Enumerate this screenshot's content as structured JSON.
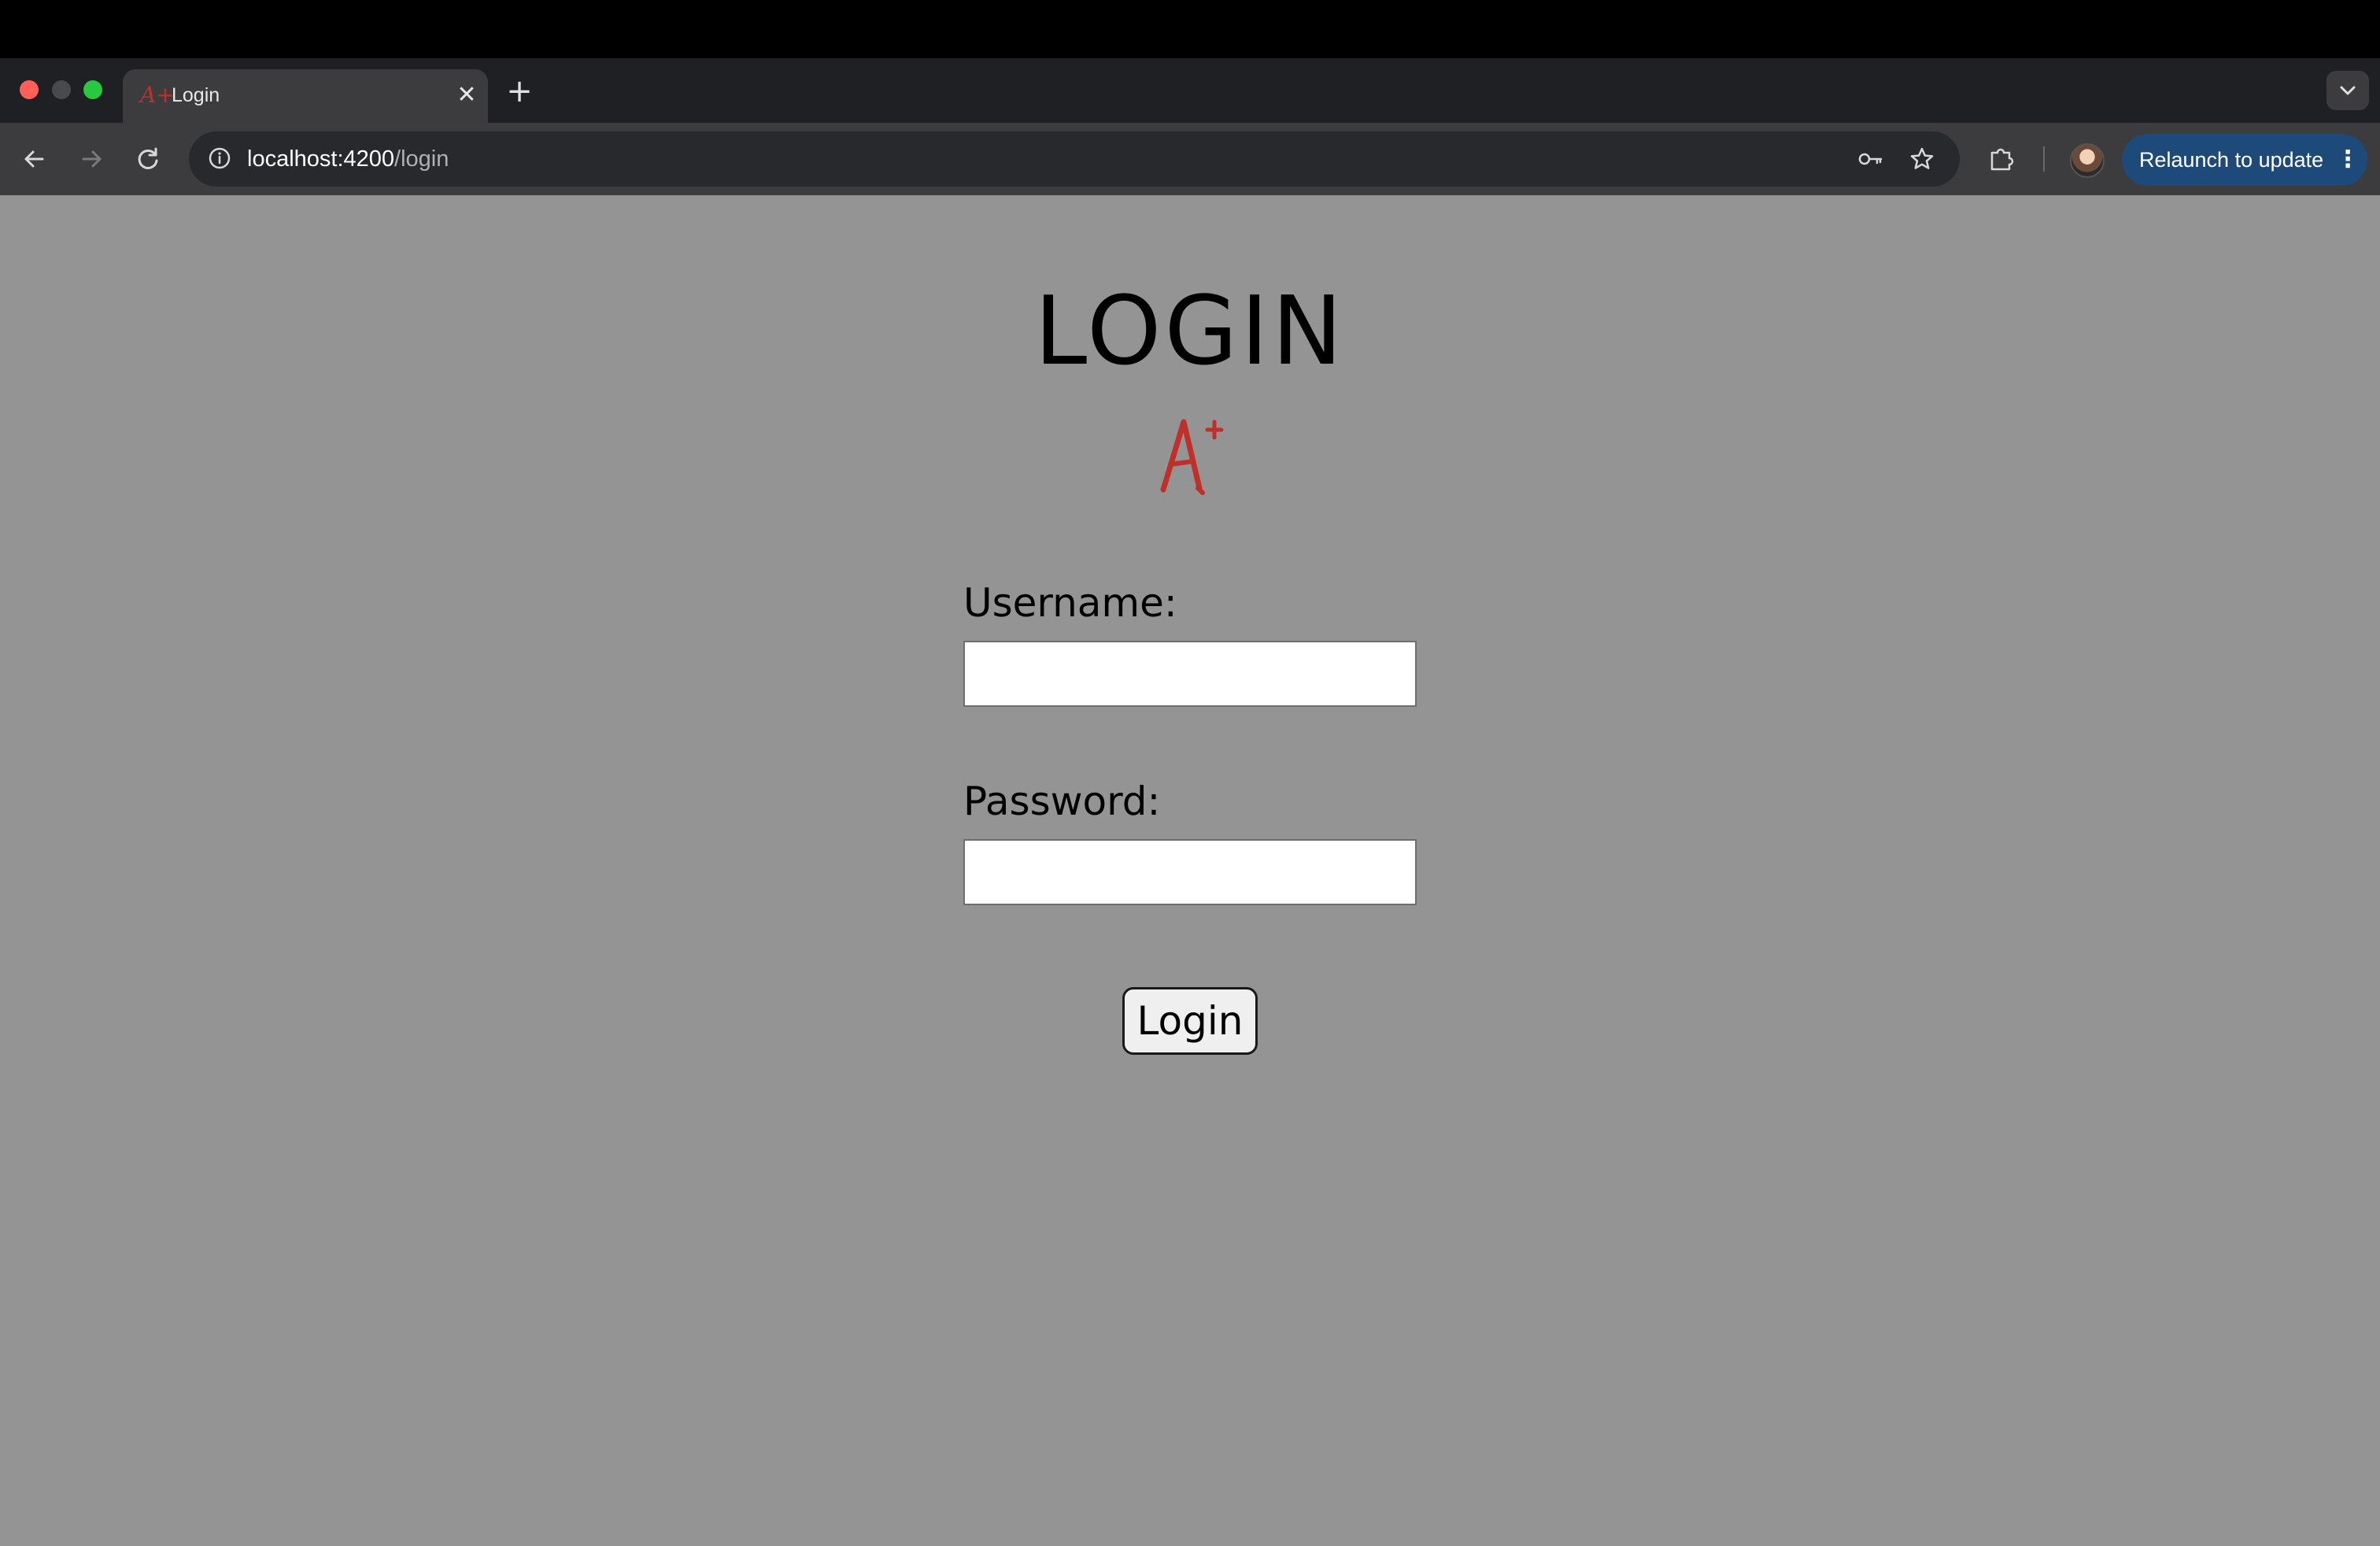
{
  "browser": {
    "tab": {
      "title": "Login",
      "favicon": "A+",
      "close_glyph": "✕"
    },
    "new_tab_glyph": "+",
    "address_bar": {
      "host": "localhost:4200",
      "path": "/login"
    },
    "relaunch_button": {
      "label": "Relaunch to update",
      "more_glyph": "⋮"
    },
    "icons": {
      "back": "back-arrow-icon",
      "forward": "forward-arrow-icon",
      "reload": "reload-icon",
      "site_info": "info-icon",
      "password_key": "key-icon",
      "bookmark": "star-icon",
      "extensions": "puzzle-icon",
      "tab_search": "chevron-down-icon"
    },
    "colors": {
      "relaunch_bg": "#1e4a7a",
      "page_bg": "#949494",
      "logo_red": "#c0302a"
    }
  },
  "page": {
    "heading": "LOGIN",
    "logo_text": "A+",
    "username": {
      "label": "Username:",
      "value": "",
      "placeholder": ""
    },
    "password": {
      "label": "Password:",
      "value": "",
      "placeholder": ""
    },
    "submit_label": "Login"
  }
}
